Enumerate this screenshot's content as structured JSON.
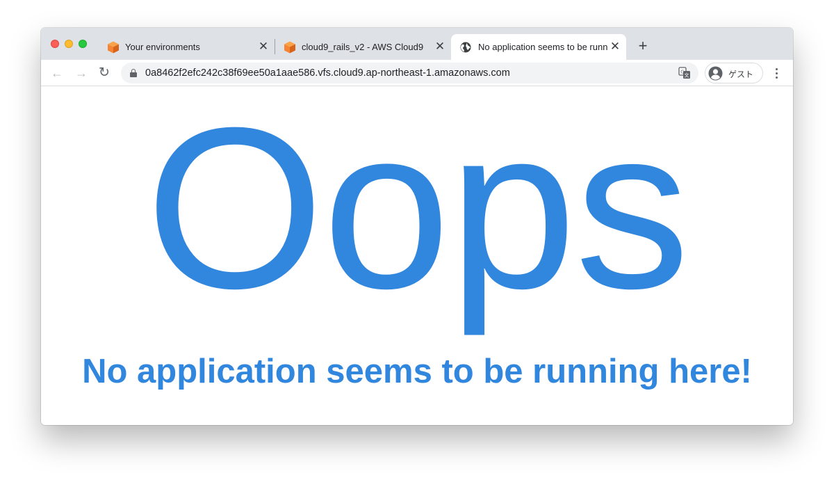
{
  "browser": {
    "tabs": [
      {
        "title": "Your environments",
        "favicon": "aws-cloud9-icon",
        "close": "✕"
      },
      {
        "title": "cloud9_rails_v2 - AWS Cloud9",
        "favicon": "aws-cloud9-icon",
        "close": "✕"
      },
      {
        "title": "No application seems to be running here!",
        "favicon": "globe-icon",
        "close": "✕",
        "active": true
      }
    ],
    "new_tab": "+",
    "nav": {
      "back": "←",
      "forward": "→",
      "reload": "↻"
    },
    "address": "0a8462f2efc242c38f69ee50a1aae586.vfs.cloud9.ap-northeast-1.amazonaws.com",
    "profile_name": "ゲスト"
  },
  "page": {
    "headline": "Oops",
    "message": "No application seems to be running here!"
  },
  "colors": {
    "accent": "#3186dd",
    "tabstrip": "#dee1e6",
    "favicon_orange": "#f58534"
  }
}
